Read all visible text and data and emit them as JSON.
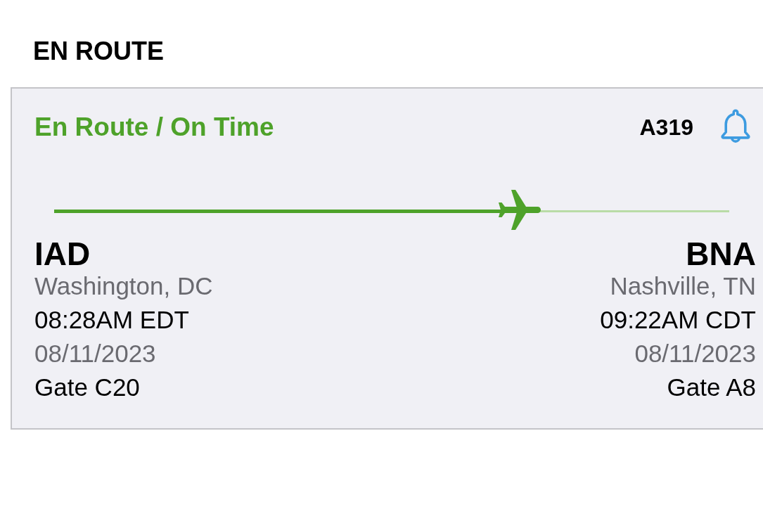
{
  "section_title": "EN ROUTE",
  "flight_card": {
    "status": "En Route / On Time",
    "aircraft": "A319",
    "progress": {
      "level": 0.69
    },
    "origin": {
      "code": "IAD",
      "city": "Washington, DC",
      "time": "08:28AM EDT",
      "date": "08/11/2023",
      "gate": "Gate C20"
    },
    "destination": {
      "code": "BNA",
      "city": "Nashville, TN",
      "time": "09:22AM CDT",
      "date": "08/11/2023",
      "gate": "Gate A8"
    }
  }
}
